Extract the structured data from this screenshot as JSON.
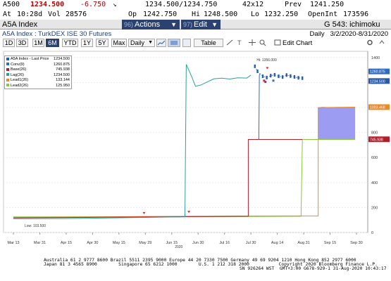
{
  "quote": {
    "symbol": "A500",
    "last": "1234.500",
    "change": "-6.750",
    "bid_ask": "1234.500/1234.750",
    "size": "42x12",
    "prev_label": "Prev",
    "prev": "1241.250",
    "time_label": "At",
    "time": "10:28d",
    "vol_label": "Vol",
    "vol": "28576",
    "open_label": "Op",
    "open": "1242.750",
    "high_label": "Hi",
    "high": "1248.500",
    "low_label": "Lo",
    "low": "1232.250",
    "oi_label": "OpenInt",
    "oi": "173596"
  },
  "titlebar": {
    "security": "A5A Index",
    "actions_num": "96)",
    "actions": "Actions",
    "edit_num": "97)",
    "edit": "Edit",
    "page": "G 543: ichimoku"
  },
  "subtitle": {
    "description": "A5A Index : TurkDEX ISE 30 Futures",
    "period": "Daily",
    "range": "3/2/2020-8/31/2020"
  },
  "toolbar": {
    "periods": [
      "1D",
      "3D",
      "1M",
      "6M",
      "YTD",
      "1Y",
      "5Y",
      "Max"
    ],
    "active_period": "6M",
    "frequency": "Daily",
    "table": "Table",
    "edit_chart": "Edit Chart"
  },
  "legend": [
    {
      "name": "A5A Index - Last Price",
      "value": "1234.500",
      "color": "#2a5aa8"
    },
    {
      "name": "Conv(9)",
      "value": "1260.875",
      "color": "#2f6bbf"
    },
    {
      "name": "Base(26)",
      "value": "745.938",
      "color": "#b0202a"
    },
    {
      "name": "Lag(26)",
      "value": "1234.500",
      "color": "#2aa198"
    },
    {
      "name": "Lead1(26)",
      "value": "133.144",
      "color": "#e8892b"
    },
    {
      "name": "Lead2(26)",
      "value": "125.950",
      "color": "#8cc63f"
    }
  ],
  "chart_data": {
    "type": "line",
    "x_labels": [
      "Mar 13",
      "Mar 31",
      "Apr 15",
      "Apr 30",
      "May 15",
      "May 29",
      "Jun 15",
      "Jun 30",
      "Jul 16",
      "Jul 30",
      "Aug 14",
      "Aug 31",
      "Sep 15",
      "Sep 30"
    ],
    "x_year": "2020",
    "y_ticks": [
      "1400",
      "1200",
      "1000",
      "800",
      "600",
      "400",
      "200",
      "0"
    ],
    "ylim": [
      0,
      1450
    ],
    "annotations": {
      "high": "Hi: 1356.000",
      "low": "Low: 103.500"
    },
    "price_tags": [
      {
        "value": "1260.875",
        "y": 1260.875,
        "color": "#2f6bbf"
      },
      {
        "value": "1234.500",
        "y": 1234.5,
        "color": "#2a5aa8"
      },
      {
        "value": "1003.468",
        "y": 1003.468,
        "color": "#e8892b"
      },
      {
        "value": "745.938",
        "y": 745.938,
        "color": "#b0202a"
      }
    ],
    "colors": {
      "price": "#2a5aa8",
      "conv": "#2f6bbf",
      "base": "#b0202a",
      "lag": "#2aa198",
      "lead1": "#e8892b",
      "lead2": "#8cc63f",
      "cloud": "#8b8cf0"
    }
  },
  "footer": {
    "line1": "Australia 61 2 9777 8600 Brazil 5511 2395 9000 Europe 44 20 7330 7500 Germany 49 69 9204 1210 Hong Kong 852 2977 6000",
    "line2": "Japan 81 3 4565 8900        Singapore 65 6212 1000        U.S. 1 212 318 2000           Copyright 2020 Bloomberg Finance L.P.",
    "line3": "SN 926264 WST  GMT+3:00 G678-929-1 31-Aug-2020 10:43:17"
  }
}
